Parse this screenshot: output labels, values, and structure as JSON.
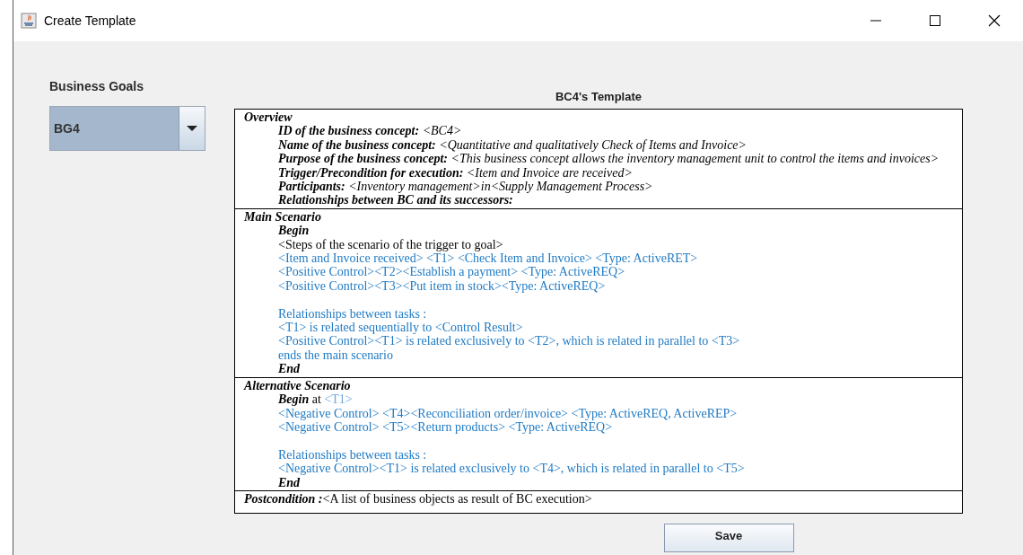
{
  "window": {
    "title": "Create Template"
  },
  "goals": {
    "label": "Business Goals",
    "value": "BG4"
  },
  "template": {
    "title": "BC4's Template",
    "sections": [
      {
        "heading": "Overview",
        "lines": [
          {
            "segments": [
              {
                "kind": "label",
                "text": "ID of the business concept:"
              },
              {
                "kind": "value",
                "text": " <BC4>"
              }
            ]
          },
          {
            "segments": [
              {
                "kind": "label",
                "text": "Name of the business concept:"
              },
              {
                "kind": "value",
                "text": " <Quantitative and qualitatively Check of Items and Invoice>"
              }
            ]
          },
          {
            "segments": [
              {
                "kind": "label",
                "text": "Purpose of the business concept:"
              },
              {
                "kind": "value",
                "text": " <This business concept allows the inventory management unit to control the items and invoices>"
              }
            ]
          },
          {
            "segments": [
              {
                "kind": "label",
                "text": "Trigger/Precondition for execution:"
              },
              {
                "kind": "value",
                "text": " <Item and Invoice are received>"
              }
            ]
          },
          {
            "segments": [
              {
                "kind": "label",
                "text": "Participants:"
              },
              {
                "kind": "value",
                "text": " <Inventory management>in<Supply Management Process>"
              }
            ]
          },
          {
            "segments": [
              {
                "kind": "label",
                "text": "Relationships between BC and its successors:"
              }
            ]
          }
        ]
      },
      {
        "heading": "Main Scenario",
        "lines": [
          {
            "segments": [
              {
                "kind": "label",
                "text": "Begin"
              }
            ]
          },
          {
            "segments": [
              {
                "kind": "plain",
                "text": "<Steps of the scenario of the trigger to goal>"
              }
            ]
          },
          {
            "segments": [
              {
                "kind": "blue",
                "text": "<Item and Invoice received> <T1> <Check Item and Invoice> <Type: ActiveRET>"
              }
            ]
          },
          {
            "segments": [
              {
                "kind": "blue",
                "text": "<Positive Control><T2><Establish a payment> <Type: ActiveREQ>"
              }
            ]
          },
          {
            "segments": [
              {
                "kind": "blue",
                "text": "<Positive Control><T3><Put item in stock><Type: ActiveREQ>"
              }
            ]
          },
          {
            "space_before": true,
            "segments": [
              {
                "kind": "blue",
                "text": "Relationships between tasks :"
              }
            ]
          },
          {
            "segments": [
              {
                "kind": "blue",
                "text": "<T1> is related sequentially to <Control Result>"
              }
            ]
          },
          {
            "segments": [
              {
                "kind": "blue",
                "text": "<Positive Control><T1> is related exclusively to <T2>, which is related in parallel to <T3>"
              }
            ]
          },
          {
            "segments": [
              {
                "kind": "blue",
                "text": "ends the main scenario"
              }
            ]
          },
          {
            "segments": [
              {
                "kind": "label",
                "text": "End"
              }
            ]
          }
        ]
      },
      {
        "heading": "Alternative Scenario",
        "lines": [
          {
            "segments": [
              {
                "kind": "label",
                "text": "Begin"
              },
              {
                "kind": "plain",
                "text": " at "
              },
              {
                "kind": "light",
                "text": "<T1>"
              }
            ]
          },
          {
            "segments": [
              {
                "kind": "blue",
                "text": "<Negative Control> <T4><Reconciliation order/invoice> <Type: ActiveREQ, ActiveREP>"
              }
            ]
          },
          {
            "segments": [
              {
                "kind": "blue",
                "text": "<Negative Control> <T5><Return products> <Type: ActiveREQ>"
              }
            ]
          },
          {
            "space_before": true,
            "segments": [
              {
                "kind": "blue",
                "text": "Relationships between tasks :"
              }
            ]
          },
          {
            "segments": [
              {
                "kind": "blue",
                "text": "<Negative Control><T1> is related exclusively to <T4>, which is related in parallel to <T5>"
              }
            ]
          },
          {
            "segments": [
              {
                "kind": "label",
                "text": "End"
              }
            ]
          }
        ]
      },
      {
        "heading": "Postcondition :",
        "note": "<A list of business objects as result of BC execution>"
      }
    ]
  },
  "buttons": [
    {
      "label": "Save"
    }
  ]
}
